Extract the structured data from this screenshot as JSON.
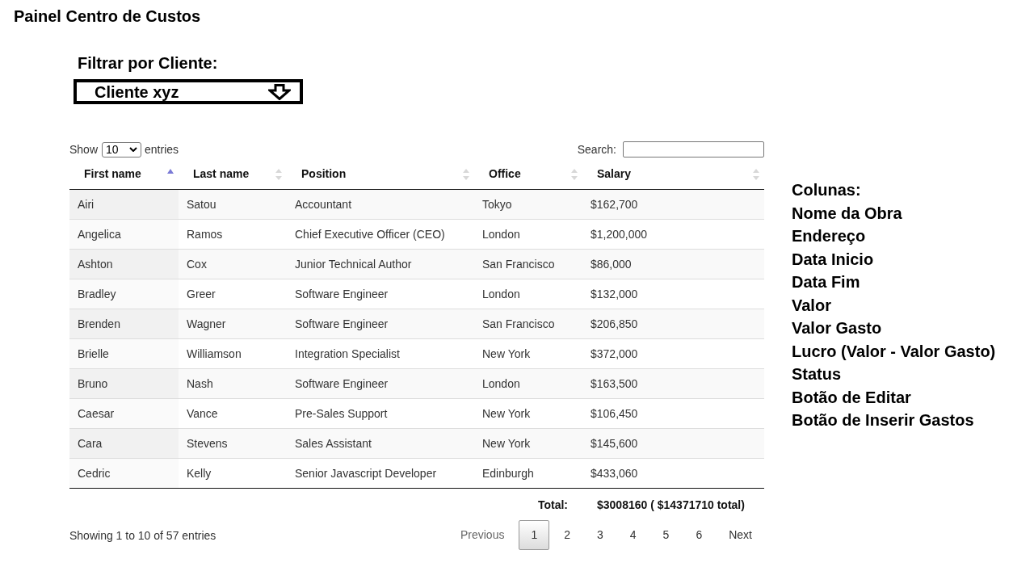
{
  "page": {
    "title": "Painel Centro de Custos"
  },
  "client_filter": {
    "label": "Filtrar por Cliente:",
    "value": "Cliente xyz"
  },
  "table": {
    "length_menu": {
      "prefix": "Show",
      "value": "10",
      "suffix": "entries"
    },
    "search": {
      "label": "Search:"
    },
    "columns": [
      {
        "label": "First name",
        "sorted": true
      },
      {
        "label": "Last name",
        "sorted": false
      },
      {
        "label": "Position",
        "sorted": false
      },
      {
        "label": "Office",
        "sorted": false
      },
      {
        "label": "Salary",
        "sorted": false
      }
    ],
    "rows": [
      [
        "Airi",
        "Satou",
        "Accountant",
        "Tokyo",
        "$162,700"
      ],
      [
        "Angelica",
        "Ramos",
        "Chief Executive Officer (CEO)",
        "London",
        "$1,200,000"
      ],
      [
        "Ashton",
        "Cox",
        "Junior Technical Author",
        "San Francisco",
        "$86,000"
      ],
      [
        "Bradley",
        "Greer",
        "Software Engineer",
        "London",
        "$132,000"
      ],
      [
        "Brenden",
        "Wagner",
        "Software Engineer",
        "San Francisco",
        "$206,850"
      ],
      [
        "Brielle",
        "Williamson",
        "Integration Specialist",
        "New York",
        "$372,000"
      ],
      [
        "Bruno",
        "Nash",
        "Software Engineer",
        "London",
        "$163,500"
      ],
      [
        "Caesar",
        "Vance",
        "Pre-Sales Support",
        "New York",
        "$106,450"
      ],
      [
        "Cara",
        "Stevens",
        "Sales Assistant",
        "New York",
        "$145,600"
      ],
      [
        "Cedric",
        "Kelly",
        "Senior Javascript Developer",
        "Edinburgh",
        "$433,060"
      ]
    ],
    "footer": {
      "label": "Total:",
      "value": "$3008160 ( $14371710 total)"
    },
    "info": "Showing 1 to 10 of 57 entries",
    "pagination": {
      "previous": {
        "label": "Previous",
        "disabled": true
      },
      "pages": [
        {
          "label": "1",
          "selected": true
        },
        {
          "label": "2",
          "selected": false
        },
        {
          "label": "3",
          "selected": false
        },
        {
          "label": "4",
          "selected": false
        },
        {
          "label": "5",
          "selected": false
        },
        {
          "label": "6",
          "selected": false
        }
      ],
      "next": {
        "label": "Next",
        "disabled": false
      }
    }
  },
  "notes": {
    "title": "Colunas:",
    "items": [
      "Nome da Obra",
      "Endereço",
      "Data Inicio",
      "Data Fim",
      "Valor",
      "Valor Gasto",
      "Lucro (Valor - Valor Gasto)",
      "Status",
      "Botão de Editar",
      "Botão de Inserir Gastos"
    ]
  }
}
